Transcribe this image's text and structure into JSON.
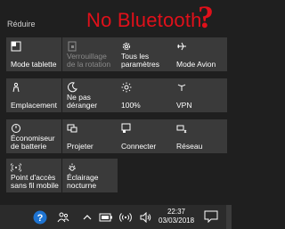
{
  "header": {
    "collapse_label": "Réduire"
  },
  "annotation": {
    "text": "No Bluetooth",
    "mark": "?",
    "color": "#e0101a"
  },
  "tiles": [
    {
      "label": "Mode tablette",
      "icon": "tablet-mode-icon",
      "enabled": true
    },
    {
      "label": "Verrouillage de la rotation",
      "icon": "rotation-lock-icon",
      "enabled": false
    },
    {
      "label": "Tous les paramètres",
      "icon": "settings-gear-icon",
      "enabled": true
    },
    {
      "label": "Mode Avion",
      "icon": "airplane-icon",
      "enabled": true
    },
    {
      "label": "Emplacement",
      "icon": "location-icon",
      "enabled": true
    },
    {
      "label": "Ne pas déranger",
      "icon": "moon-icon",
      "enabled": true
    },
    {
      "label": "100%",
      "icon": "brightness-icon",
      "enabled": true
    },
    {
      "label": "VPN",
      "icon": "vpn-icon",
      "enabled": true
    },
    {
      "label": "Économiseur de batterie",
      "icon": "battery-saver-icon",
      "enabled": true
    },
    {
      "label": "Projeter",
      "icon": "project-icon",
      "enabled": true
    },
    {
      "label": "Connecter",
      "icon": "connect-icon",
      "enabled": true
    },
    {
      "label": "Réseau",
      "icon": "network-icon",
      "enabled": true
    },
    {
      "label": "Point d'accès sans fil mobile",
      "icon": "mobile-hotspot-icon",
      "enabled": true
    },
    {
      "label": "Éclairage nocturne",
      "icon": "night-light-icon",
      "enabled": true
    }
  ],
  "taskbar": {
    "time": "22:37",
    "date": "03/03/2018",
    "icons": [
      "help-icon",
      "people-icon",
      "show-hidden-icons-chevron",
      "battery-icon",
      "wifi-icon",
      "volume-icon",
      "notifications-icon"
    ]
  },
  "colors": {
    "tile_bg": "#3a3a3a",
    "panel_bg": "#1f1f1f",
    "taskbar_bg": "#2b2b2b",
    "help_blue": "#1e74d2"
  }
}
